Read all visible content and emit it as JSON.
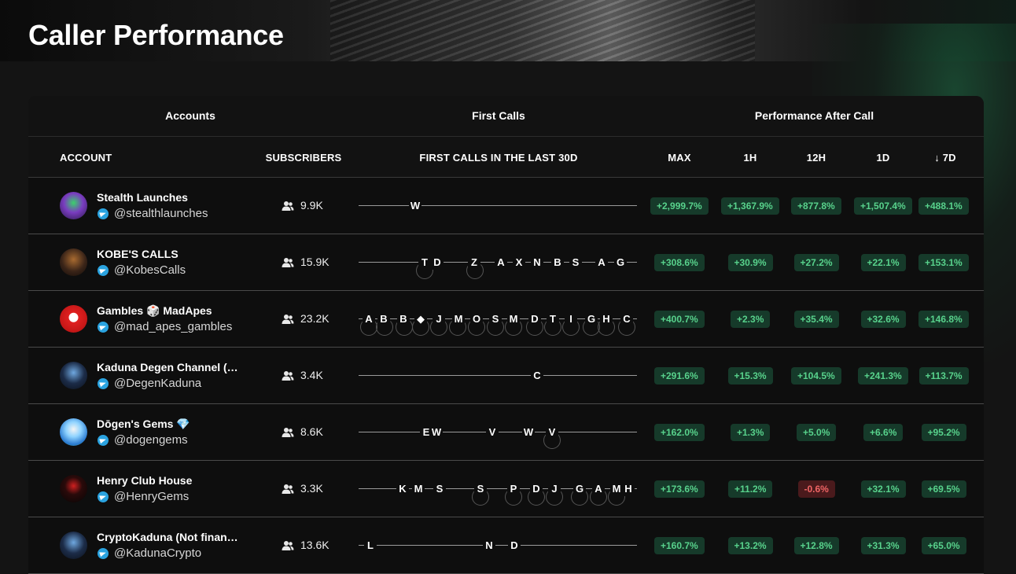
{
  "page_title": "Caller Performance",
  "group_headers": {
    "accounts": "Accounts",
    "first_calls": "First Calls",
    "performance": "Performance After Call"
  },
  "columns": {
    "account": "ACCOUNT",
    "subscribers": "SUBSCRIBERS",
    "first_calls": "FIRST CALLS IN THE LAST 30D",
    "max": "MAX",
    "h1": "1H",
    "h12": "12H",
    "d1": "1D",
    "d7": "↓ 7D"
  },
  "colors": {
    "positive_text": "#58d28c",
    "positive_bg": "#163a2a",
    "negative_text": "#f06565",
    "negative_bg": "#4a1a1c",
    "telegram": "#2aa3e0"
  },
  "icons": {
    "subscribers": "users-icon",
    "channel": "telegram-icon"
  },
  "rows": [
    {
      "name": "Stealth Launches",
      "handle": "@stealthlaunches",
      "subscribers": "9.9K",
      "calls": [
        "W"
      ],
      "max": "+2,999.7%",
      "h1": "+1,367.9%",
      "h12": "+877.8%",
      "d1": "+1,507.4%",
      "d7": "+488.1%"
    },
    {
      "name": "KOBE'S CALLS",
      "handle": "@KobesCalls",
      "subscribers": "15.9K",
      "calls": [
        "T",
        "D",
        "Z",
        "A",
        "X",
        "N",
        "B",
        "S",
        "A",
        "G"
      ],
      "max": "+308.6%",
      "h1": "+30.9%",
      "h12": "+27.2%",
      "d1": "+22.1%",
      "d7": "+153.1%"
    },
    {
      "name": "Gambles 🎲 MadApes",
      "handle": "@mad_apes_gambles",
      "subscribers": "23.2K",
      "calls": [
        "A",
        "B",
        "B",
        "◆",
        "J",
        "M",
        "O",
        "S",
        "M",
        "D",
        "T",
        "I",
        "G",
        "H",
        "C"
      ],
      "max": "+400.7%",
      "h1": "+2.3%",
      "h12": "+35.4%",
      "d1": "+32.6%",
      "d7": "+146.8%"
    },
    {
      "name": "Kaduna Degen Channel (…",
      "handle": "@DegenKaduna",
      "subscribers": "3.4K",
      "calls": [
        "C"
      ],
      "max": "+291.6%",
      "h1": "+15.3%",
      "h12": "+104.5%",
      "d1": "+241.3%",
      "d7": "+113.7%"
    },
    {
      "name": "Dōgen's Gems 💎",
      "handle": "@dogengems",
      "subscribers": "8.6K",
      "calls": [
        "E",
        "W",
        "V",
        "W",
        "V"
      ],
      "max": "+162.0%",
      "h1": "+1.3%",
      "h12": "+5.0%",
      "d1": "+6.6%",
      "d7": "+95.2%"
    },
    {
      "name": "Henry Club House",
      "handle": "@HenryGems",
      "subscribers": "3.3K",
      "calls": [
        "K",
        "M",
        "S",
        "S",
        "P",
        "D",
        "J",
        "G",
        "A",
        "M",
        "H"
      ],
      "max": "+173.6%",
      "h1": "+11.2%",
      "h12": "-0.6%",
      "d1": "+32.1%",
      "d7": "+69.5%"
    },
    {
      "name": "CryptoKaduna (Not finan…",
      "handle": "@KadunaCrypto",
      "subscribers": "13.6K",
      "calls": [
        "L",
        "N",
        "D"
      ],
      "max": "+160.7%",
      "h1": "+13.2%",
      "h12": "+12.8%",
      "d1": "+31.3%",
      "d7": "+65.0%"
    }
  ]
}
